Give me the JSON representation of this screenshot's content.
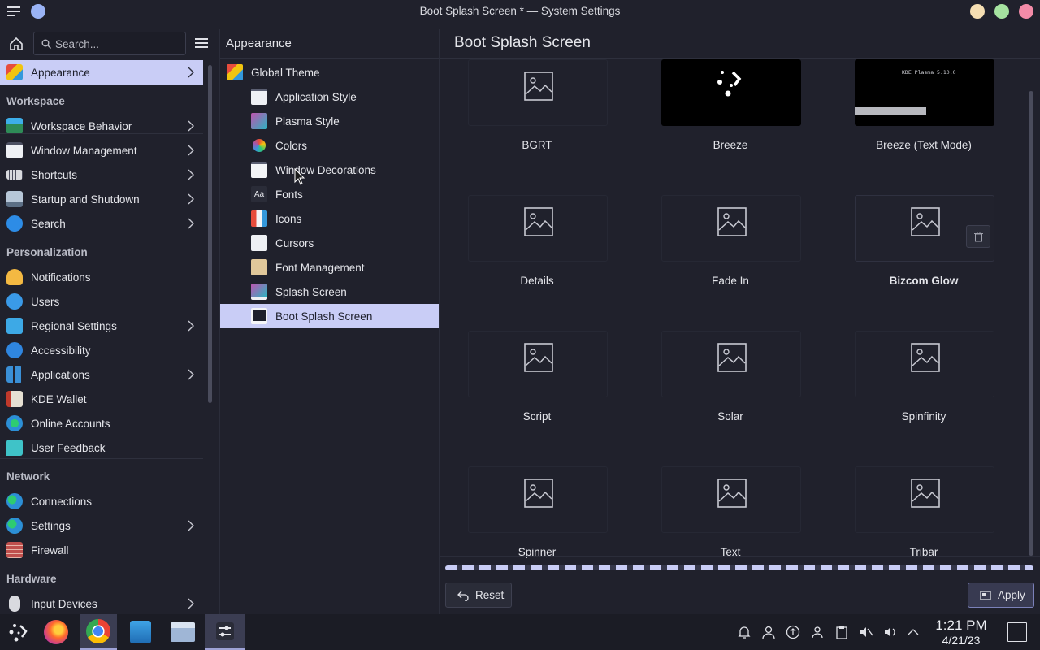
{
  "window": {
    "title": "Boot Splash Screen * — System Settings",
    "buttons": [
      "minimize",
      "maximize",
      "close"
    ],
    "button_colors": {
      "minimize": "#f5deb3",
      "maximize": "#a6e3a1",
      "close": "#f38ba8"
    }
  },
  "sidebar": {
    "search_placeholder": "Search...",
    "items": [
      {
        "label": "Appearance",
        "active": true,
        "chevron": true,
        "icon": "appearance-icon"
      },
      {
        "section": "Workspace"
      },
      {
        "label": "Workspace Behavior",
        "chevron": true,
        "icon": "workspace-behavior-icon"
      },
      {
        "label": "Window Management",
        "chevron": true,
        "icon": "window-management-icon"
      },
      {
        "label": "Shortcuts",
        "chevron": true,
        "icon": "keyboard-icon"
      },
      {
        "label": "Startup and Shutdown",
        "chevron": true,
        "icon": "startup-icon"
      },
      {
        "label": "Search",
        "chevron": true,
        "icon": "search-icon"
      },
      {
        "section": "Personalization"
      },
      {
        "label": "Notifications",
        "icon": "bell-icon"
      },
      {
        "label": "Users",
        "icon": "users-icon"
      },
      {
        "label": "Regional Settings",
        "chevron": true,
        "icon": "regional-icon"
      },
      {
        "label": "Accessibility",
        "icon": "accessibility-icon"
      },
      {
        "label": "Applications",
        "chevron": true,
        "icon": "applications-icon"
      },
      {
        "label": "KDE Wallet",
        "icon": "wallet-icon"
      },
      {
        "label": "Online Accounts",
        "icon": "online-accounts-icon"
      },
      {
        "label": "User Feedback",
        "icon": "feedback-icon"
      },
      {
        "section": "Network"
      },
      {
        "label": "Connections",
        "icon": "globe-icon"
      },
      {
        "label": "Settings",
        "chevron": true,
        "icon": "globe-settings-icon"
      },
      {
        "label": "Firewall",
        "icon": "firewall-icon"
      },
      {
        "section": "Hardware"
      },
      {
        "label": "Input Devices",
        "chevron": true,
        "icon": "mouse-icon"
      }
    ]
  },
  "appearance": {
    "title": "Appearance",
    "items": [
      {
        "label": "Global Theme",
        "level": 0
      },
      {
        "label": "Application Style",
        "level": 1
      },
      {
        "label": "Plasma Style",
        "level": 1
      },
      {
        "label": "Colors",
        "level": 1
      },
      {
        "label": "Window Decorations",
        "level": 1
      },
      {
        "label": "Fonts",
        "level": 1
      },
      {
        "label": "Icons",
        "level": 1
      },
      {
        "label": "Cursors",
        "level": 1
      },
      {
        "label": "Font Management",
        "level": 1
      },
      {
        "label": "Splash Screen",
        "level": 1
      },
      {
        "label": "Boot Splash Screen",
        "level": 1,
        "active": true
      }
    ]
  },
  "main": {
    "title": "Boot Splash Screen",
    "themes": [
      {
        "label": "BGRT",
        "preview": "placeholder"
      },
      {
        "label": "Breeze",
        "preview": "breeze"
      },
      {
        "label": "Breeze (Text Mode)",
        "preview": "text",
        "preview_text": "KDE Plasma 5.10.0"
      },
      {
        "label": "Details",
        "preview": "placeholder"
      },
      {
        "label": "Fade In",
        "preview": "placeholder"
      },
      {
        "label": "Bizcom Glow",
        "preview": "placeholder",
        "selected": true
      },
      {
        "label": "Script",
        "preview": "placeholder"
      },
      {
        "label": "Solar",
        "preview": "placeholder"
      },
      {
        "label": "Spinfinity",
        "preview": "placeholder"
      },
      {
        "label": "Spinner",
        "preview": "placeholder"
      },
      {
        "label": "Text",
        "preview": "placeholder"
      },
      {
        "label": "Tribar",
        "preview": "placeholder"
      }
    ],
    "reset_label": "Reset",
    "apply_label": "Apply"
  },
  "taskbar": {
    "apps": [
      "application-launcher",
      "firefox",
      "chrome",
      "discover",
      "dolphin",
      "system-settings"
    ],
    "time": "1:21 PM",
    "date": "4/21/23"
  },
  "colors": {
    "accent": "#c9cdf6",
    "background": "#20212c",
    "taskbar": "#1b1c25"
  }
}
